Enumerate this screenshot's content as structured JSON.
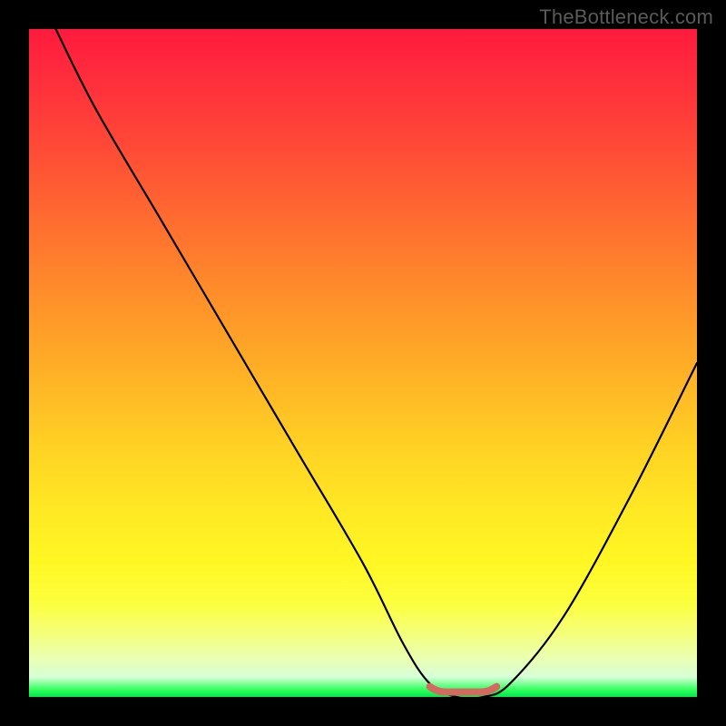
{
  "watermark": "TheBottleneck.com",
  "colors": {
    "background": "#000000",
    "gradient_top": "#ff1a3d",
    "gradient_mid": "#ffe824",
    "gradient_bottom": "#00e84a",
    "curve": "#000000",
    "marker": "#d46a5f"
  },
  "chart_data": {
    "type": "line",
    "title": "",
    "xlabel": "",
    "ylabel": "",
    "xlim": [
      0,
      100
    ],
    "ylim": [
      0,
      100
    ],
    "series": [
      {
        "name": "bottleneck-curve",
        "x": [
          4,
          10,
          20,
          30,
          40,
          50,
          56,
          60,
          64,
          68,
          72,
          80,
          90,
          100
        ],
        "y": [
          100,
          88,
          71,
          54,
          37,
          20,
          8,
          2,
          0,
          0,
          2,
          12,
          30,
          50
        ]
      }
    ],
    "annotations": [
      {
        "name": "plateau-marker",
        "x_range": [
          60,
          70
        ],
        "y": 1
      }
    ],
    "grid": false,
    "legend": false
  }
}
